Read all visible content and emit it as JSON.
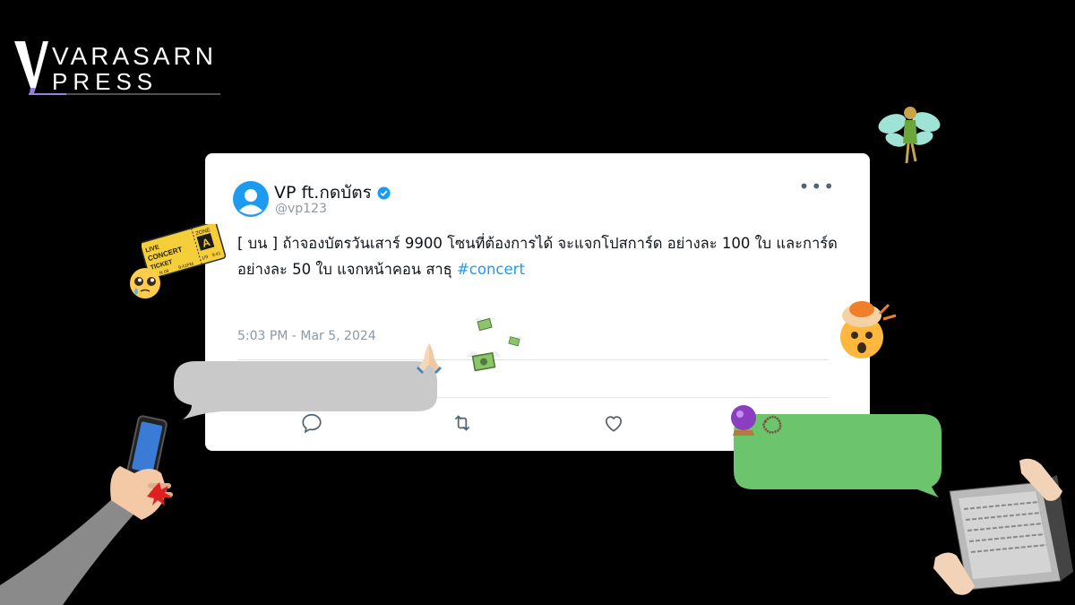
{
  "logo": {
    "line1": "VARASARN",
    "line2": "PRESS",
    "mark_letter": "V"
  },
  "tweet": {
    "display_name": "VP ft.กดบัตร",
    "handle": "@vp123",
    "text_before_hashtag": "[ บน ] ถ้าจองบัตรวันเสาร์ 9900 โซนที่ต้องการได้ จะแจกโปสการ์ด อย่างละ 100 ใบ และการ์ด อย่างละ 50 ใบ แจกหน้าคอน สาธุ ",
    "hashtag": "#concert",
    "timestamp": "5:03 PM - Mar 5, 2024",
    "more_label": "•••",
    "actions": [
      "reply-icon",
      "retweet-icon",
      "like-icon"
    ]
  },
  "ticket_sticker": {
    "live": "LIVE",
    "concert": "CONCERT",
    "ticket": "TICKET",
    "zone_label": "ZONE",
    "zone": "A",
    "time": "9:41PM",
    "time2": "9:41",
    "no": "N 09",
    "date": "1/9"
  },
  "colors": {
    "background": "#000000",
    "card": "#ffffff",
    "accent_blue": "#1d9bf0",
    "verified": "#1d9bf0",
    "bubble_green": "#6cc46c",
    "bubble_gray": "#c8c8c8",
    "logo_purple": "#9b7fe0"
  },
  "icons": [
    "verified-badge-icon",
    "avatar-icon",
    "fairy-emoji",
    "exploding-head-emoji",
    "pleading-face-emoji",
    "praying-hands-emoji",
    "money-wings-emoji",
    "crystal-ball-emoji",
    "prayer-beads-emoji",
    "anger-symbol-icon",
    "clapping-hands-emoji",
    "phone-hand-illustration",
    "laptop-illustration"
  ]
}
